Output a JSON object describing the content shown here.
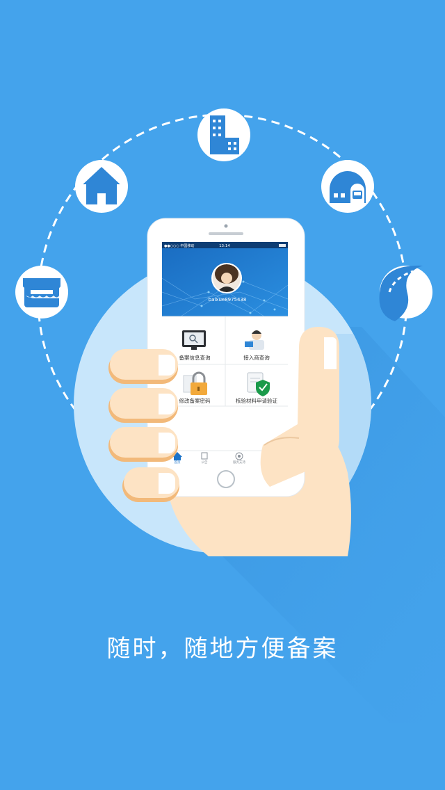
{
  "splash": {
    "tagline": "随时，随地方便备案"
  },
  "phone": {
    "status_bar": {
      "carrier": "●●○○○ 中国移动",
      "time": "13:14"
    },
    "profile": {
      "username": "baixue8975438"
    },
    "grid": [
      {
        "label": "备案信息查询",
        "icon": "monitor-search-icon"
      },
      {
        "label": "接入商查询",
        "icon": "support-agent-icon"
      },
      {
        "label": "修改备案密码",
        "icon": "padlock-icon"
      },
      {
        "label": "核验材料申请验证",
        "icon": "shield-check-document-icon"
      }
    ],
    "tabbar": [
      {
        "label": "首页",
        "icon": "home-icon"
      },
      {
        "label": "公告",
        "icon": "announcement-icon"
      },
      {
        "label": "服务支持",
        "icon": "service-icon"
      }
    ]
  },
  "floating_icons": [
    "store-icon",
    "house-icon",
    "buildings-icon",
    "train-station-icon",
    "highway-icon"
  ],
  "colors": {
    "background": "#44a3ec",
    "circle": "#c8e6fb",
    "icon_blue": "#2f86d6",
    "phone_header": "#1b73c9",
    "hand": "#fde3c4",
    "hand_shadow": "#f2b97a"
  }
}
